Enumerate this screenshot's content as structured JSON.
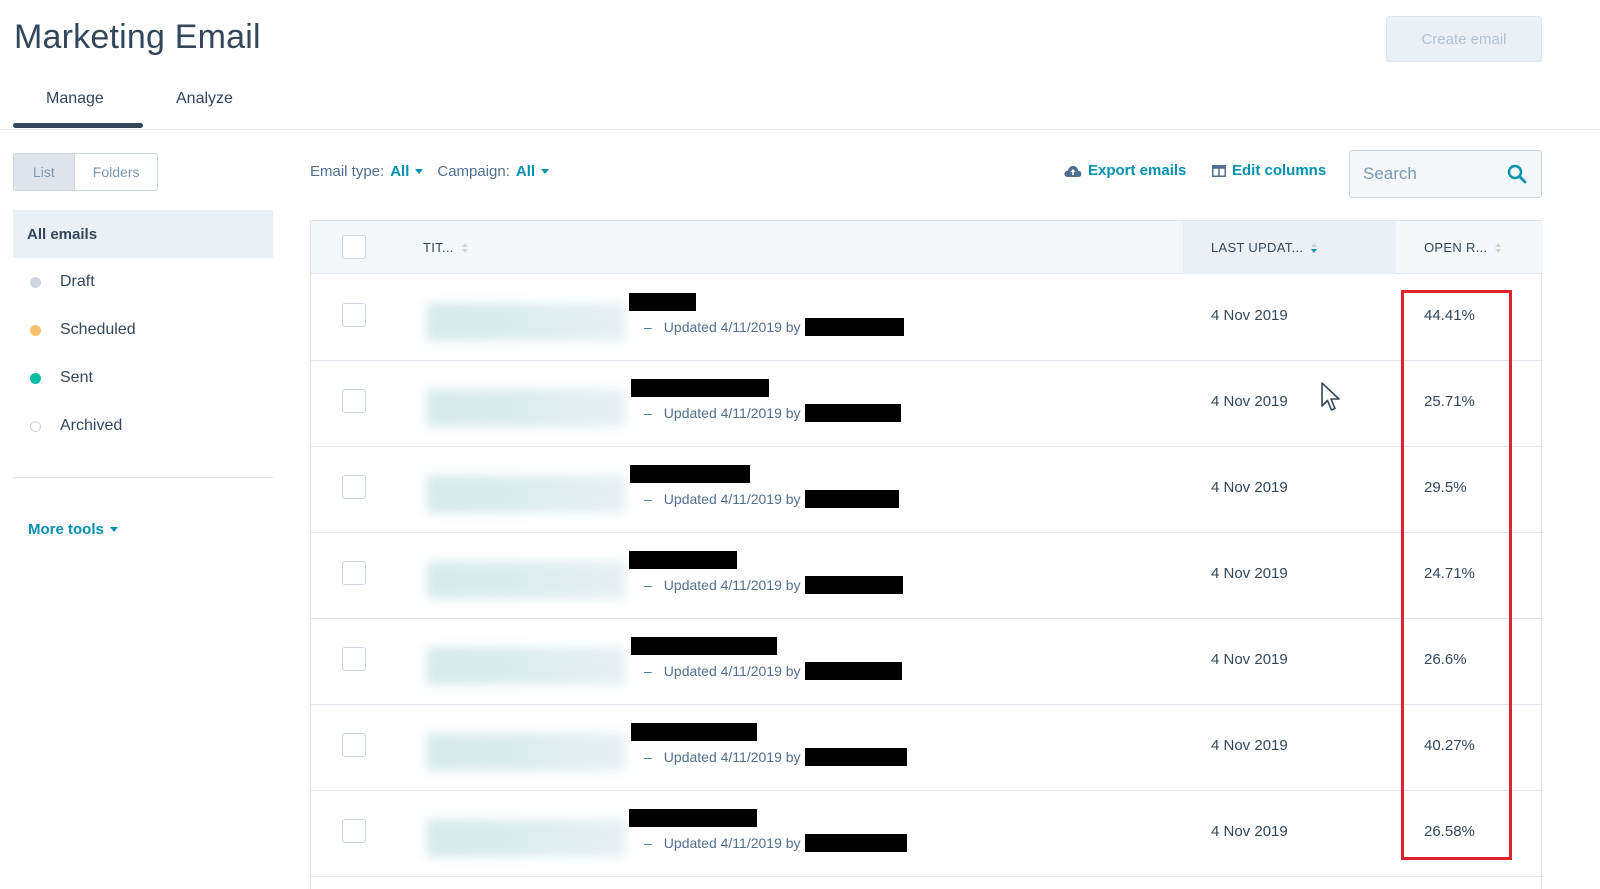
{
  "header": {
    "title": "Marketing Email",
    "create_button": "Create email"
  },
  "tabs": [
    {
      "label": "Manage",
      "active": true
    },
    {
      "label": "Analyze",
      "active": false
    }
  ],
  "view_toggle": {
    "list": "List",
    "folders": "Folders",
    "active": "List"
  },
  "sidebar": {
    "items": [
      {
        "label": "All emails",
        "active": true
      },
      {
        "label": "Draft",
        "dot_color": "#cbd6e2"
      },
      {
        "label": "Scheduled",
        "dot_color": "#f5c26b"
      },
      {
        "label": "Sent",
        "dot_color": "#00bda5"
      },
      {
        "label": "Archived",
        "dot_color": "outline"
      }
    ],
    "more_tools": "More tools"
  },
  "filters": {
    "email_type_label": "Email type:",
    "email_type_value": "All",
    "campaign_label": "Campaign:",
    "campaign_value": "All"
  },
  "actions": {
    "export": "Export emails",
    "edit_columns": "Edit columns"
  },
  "search": {
    "placeholder": "Search"
  },
  "table": {
    "columns": {
      "title": "TIT...",
      "last_updated": "LAST UPDAT...",
      "open_rate": "OPEN R..."
    },
    "rows": [
      {
        "updated": "Updated 4/11/2019 by",
        "last_updated": "4 Nov 2019",
        "open_rate": "44.41%"
      },
      {
        "updated": "Updated 4/11/2019 by",
        "last_updated": "4 Nov 2019",
        "open_rate": "25.71%"
      },
      {
        "updated": "Updated 4/11/2019 by",
        "last_updated": "4 Nov 2019",
        "open_rate": "29.5%"
      },
      {
        "updated": "Updated 4/11/2019 by",
        "last_updated": "4 Nov 2019",
        "open_rate": "24.71%"
      },
      {
        "updated": "Updated 4/11/2019 by",
        "last_updated": "4 Nov 2019",
        "open_rate": "26.6%"
      },
      {
        "updated": "Updated 4/11/2019 by",
        "last_updated": "4 Nov 2019",
        "open_rate": "40.27%"
      },
      {
        "updated": "Updated 4/11/2019 by",
        "last_updated": "4 Nov 2019",
        "open_rate": "26.58%"
      }
    ]
  },
  "colors": {
    "accent": "#0091ae",
    "text": "#33475b",
    "highlight": "#e0222b"
  }
}
